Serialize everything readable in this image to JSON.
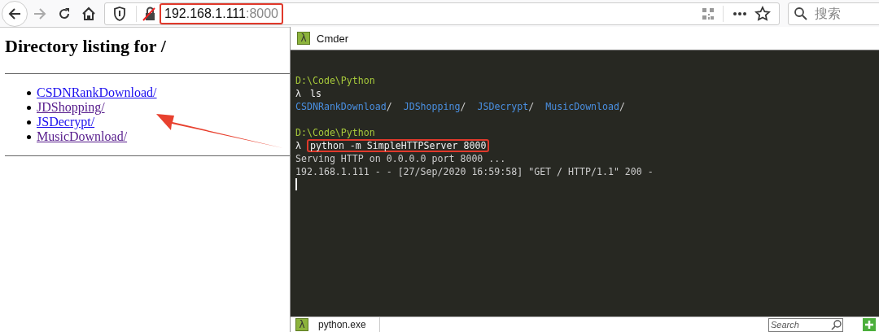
{
  "toolbar": {
    "address": {
      "host": "192.168.1.111",
      "port": ":8000",
      "highlighted": true
    },
    "search": {
      "placeholder": "搜索"
    }
  },
  "page": {
    "heading": "Directory listing for /",
    "links": [
      {
        "text": "CSDNRankDownload/",
        "visited": false
      },
      {
        "text": "JDShopping/",
        "visited": true
      },
      {
        "text": "JSDecrypt/",
        "visited": false
      },
      {
        "text": "MusicDownload/",
        "visited": true
      }
    ]
  },
  "terminal": {
    "icon_glyph": "λ",
    "title": "Cmder",
    "lines": [
      {
        "kind": "blank"
      },
      {
        "kind": "path",
        "text": "D:\\Code\\Python"
      },
      {
        "kind": "prompt",
        "symbol": "λ",
        "command": "ls",
        "highlighted": false
      },
      {
        "kind": "listing",
        "items": [
          {
            "name": "CSDNRankDownload",
            "suffix": "/"
          },
          {
            "name": "JDShopping",
            "suffix": "/"
          },
          {
            "name": "JSDecrypt",
            "suffix": "/"
          },
          {
            "name": "MusicDownload",
            "suffix": "/"
          }
        ]
      },
      {
        "kind": "blank"
      },
      {
        "kind": "path",
        "text": "D:\\Code\\Python"
      },
      {
        "kind": "prompt",
        "symbol": "λ",
        "command": "python -m SimpleHTTPServer 8000",
        "highlighted": true
      },
      {
        "kind": "output",
        "text": "Serving HTTP on 0.0.0.0 port 8000 ..."
      },
      {
        "kind": "output",
        "text": "192.168.1.111 - - [27/Sep/2020 16:59:58] \"GET / HTTP/1.1\" 200 -"
      },
      {
        "kind": "cursor"
      }
    ],
    "taskbar": {
      "tab": {
        "icon_glyph": "λ",
        "label": "python.exe"
      },
      "search": {
        "placeholder": "Search"
      }
    }
  }
}
